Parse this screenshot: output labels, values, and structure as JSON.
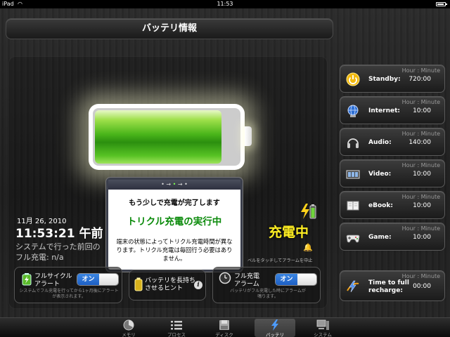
{
  "status_bar": {
    "carrier": "iPad",
    "wifi_icon": "wifi-icon",
    "time": "11:53"
  },
  "header": {
    "title": "バッテリ情報"
  },
  "battery": {
    "level_percent": 88,
    "fill_color": "#3fae17"
  },
  "info_box": {
    "line1": "もう少しで充電が完了します",
    "line2": "トリクル充電の実行中",
    "body": "端末の状態によってトリクル充電時間が異なります。トリクル充電は毎回行う必要はありません。",
    "step_dots": [
      "•",
      "→",
      "•",
      "→",
      "•"
    ]
  },
  "datetime": {
    "date": "11月 26, 2010",
    "time": "11:53:21 午前",
    "last_charge_line1": "システムで行った前回の",
    "last_charge_line2": "フル充電: n/a"
  },
  "charge_state": {
    "label": "充電中",
    "alarm_hint": "ベルをタッチしてアラームを中止",
    "label_color": "#ffee22"
  },
  "options": {
    "cycle_alert": {
      "title_line1": "フルサイクル",
      "title_line2": "アラート",
      "toggle": "オン",
      "sub": "システムでフル充電を行ってから1ヶ月後にアラートが表示されます。"
    },
    "hints": {
      "title_line1": "バッテリを長持ち",
      "title_line2": "させるヒント"
    },
    "full_charge_alarm": {
      "title_line1": "フル充電",
      "title_line2": "アラーム",
      "toggle": "オン",
      "sub": "バッテリがフル充電した時にアラームが鳴ります。"
    }
  },
  "stats": {
    "header": "Hour : Minute",
    "items": [
      {
        "name": "Standby:",
        "value": "720:00",
        "icon": "power-icon"
      },
      {
        "name": "Internet:",
        "value": "10:00",
        "icon": "globe-icon"
      },
      {
        "name": "Audio:",
        "value": "140:00",
        "icon": "headphones-icon"
      },
      {
        "name": "Video:",
        "value": "10:00",
        "icon": "film-icon"
      },
      {
        "name": "eBook:",
        "value": "10:00",
        "icon": "book-icon"
      },
      {
        "name": "Game:",
        "value": "10:00",
        "icon": "gamepad-icon"
      }
    ],
    "recharge": {
      "name_line1": "Time to full",
      "name_line2": "recharge:",
      "value": "00:00",
      "icon": "bolt-icon"
    }
  },
  "tabs": [
    {
      "label": "メモリ",
      "icon": "memory-icon"
    },
    {
      "label": "プロセス",
      "icon": "list-icon"
    },
    {
      "label": "ディスク",
      "icon": "disk-icon"
    },
    {
      "label": "バッテリ",
      "icon": "battery-bolt-icon",
      "active": true
    },
    {
      "label": "システム",
      "icon": "system-icon"
    }
  ]
}
